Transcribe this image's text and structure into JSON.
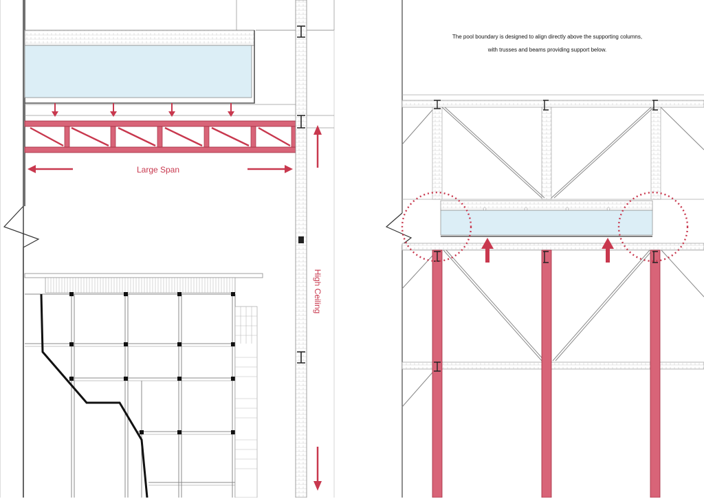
{
  "left_panel": {
    "span_label": "Large Span",
    "height_label": "High Ceiling"
  },
  "right_panel": {
    "note_line1": "The pool boundary is designed to align directly above the supporting columns,",
    "note_line2": "with trusses and beams providing support below."
  },
  "colors": {
    "accent": "#c8384e",
    "column_fill": "#d86478",
    "water": "#dceef6",
    "line": "#555555"
  }
}
